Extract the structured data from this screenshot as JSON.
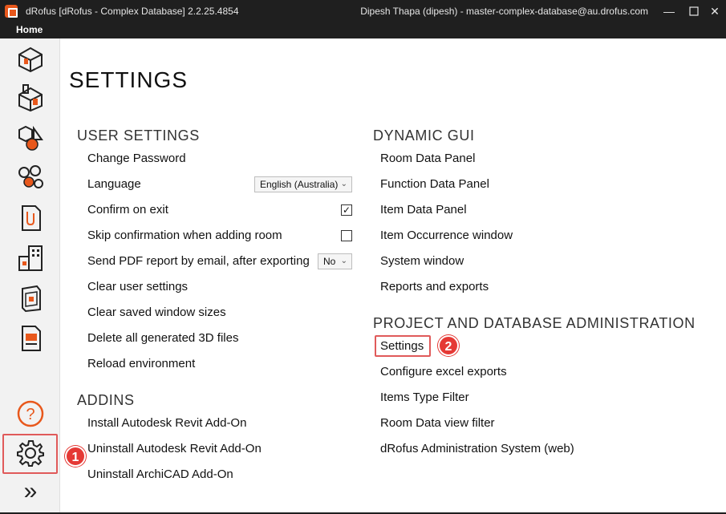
{
  "window": {
    "title": "dRofus [dRofus - Complex Database] 2.2.25.4854",
    "user": "Dipesh Thapa (dipesh) - master-complex-database@au.drofus.com",
    "minimize": "—",
    "close": "✕"
  },
  "menu": {
    "home": "Home"
  },
  "sidebar": {
    "icons": [
      "room-icon",
      "function-icon",
      "item-icon",
      "occurrence-icon",
      "document-icon",
      "building-icon",
      "package-icon",
      "report-icon",
      "help-icon",
      "settings-icon",
      "expand-icon"
    ],
    "help_glyph": "?",
    "expand_glyph": "»"
  },
  "annotations": {
    "step1": "1",
    "step2": "2",
    "highlight_color": "#e05a5a",
    "badge_color": "#e53935"
  },
  "page": {
    "title": "SETTINGS"
  },
  "user_settings": {
    "heading": "USER SETTINGS",
    "change_password": "Change Password",
    "language_label": "Language",
    "language_value": "English (Australia)",
    "confirm_exit_label": "Confirm on exit",
    "confirm_exit_checked": true,
    "confirm_exit_mark": "✓",
    "skip_confirm_label": "Skip confirmation when adding room",
    "skip_confirm_checked": false,
    "send_pdf_label": "Send PDF report by email, after exporting",
    "send_pdf_value": "No",
    "clear_user_settings": "Clear user settings",
    "clear_window_sizes": "Clear saved window sizes",
    "delete_3d": "Delete all generated 3D files",
    "reload_env": "Reload environment"
  },
  "addins": {
    "heading": "ADDINS",
    "install_revit": "Install Autodesk Revit Add-On",
    "uninstall_revit": "Uninstall Autodesk Revit Add-On",
    "uninstall_archicad": "Uninstall ArchiCAD Add-On"
  },
  "dynamic_gui": {
    "heading": "DYNAMIC GUI",
    "items": [
      "Room Data Panel",
      "Function Data Panel",
      "Item Data Panel",
      "Item Occurrence window",
      "System window",
      "Reports and exports"
    ]
  },
  "project_admin": {
    "heading": "PROJECT AND DATABASE ADMINISTRATION",
    "items": [
      "Settings",
      "Configure excel exports",
      "Items Type Filter",
      "Room Data view filter",
      "dRofus Administration System (web)"
    ]
  }
}
